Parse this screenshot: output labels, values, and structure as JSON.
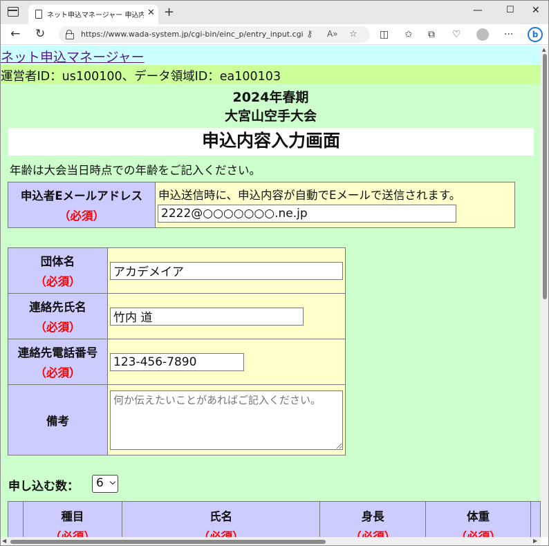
{
  "browser": {
    "tab_title": "ネット申込マネージャー 申込内容入力",
    "url": "https://www.wada-system.jp/cgi-bin/einc_p/entry_input.cgi",
    "icons": [
      "tab-actions-icon",
      "page-icon",
      "close-icon",
      "new-tab-icon",
      "minimize-icon",
      "maximize-icon",
      "window-close-icon",
      "back-icon",
      "refresh-icon",
      "lock-icon",
      "key-icon",
      "read-aloud-icon",
      "favorite-star-icon",
      "split-screen-icon",
      "favorites-icon",
      "collections-icon",
      "browser-essentials-icon",
      "profile-icon",
      "more-icon",
      "bing-icon"
    ]
  },
  "header": {
    "system_link": "ネット申込マネージャー",
    "operator_line": "運営者ID：us100100、データ領域ID：ea100103",
    "season": "2024年春期",
    "event_name": "大宮山空手大会",
    "page_heading": "申込内容入力画面",
    "age_note": "年齢は大会当日時点での年齢をご記入ください。"
  },
  "email_section": {
    "label": "申込者Eメールアドレス",
    "required": "（必須）",
    "hint": "申込送信時に、申込内容が自動でEメールで送信されます。",
    "value": "2222@○○○○○○○.ne.jp"
  },
  "group_form": {
    "org_label": "団体名",
    "org_required": "（必須）",
    "org_value": "アカデメイア",
    "contact_label": "連絡先氏名",
    "contact_required": "（必須）",
    "contact_value": "竹内 道",
    "phone_label": "連絡先電話番号",
    "phone_required": "（必須）",
    "phone_value": "123-456-7890",
    "remarks_label": "備考",
    "remarks_placeholder": "何か伝えたいことがあればご記入ください。"
  },
  "entries": {
    "count_label": "申し込む数：",
    "count_value": "6",
    "columns": [
      {
        "label": "種目",
        "required": "（必須）"
      },
      {
        "label": "氏名",
        "required": "（必須）"
      },
      {
        "label": "身長",
        "required": "（必須）"
      },
      {
        "label": "体重",
        "required": "（必須）"
      }
    ]
  },
  "colors": {
    "page_bg": "#ccffcc",
    "link_bar": "#ccffff",
    "id_bar": "#ccff99",
    "label_cell": "#ccccff",
    "value_cell": "#ffffcc",
    "required": "#ff0000"
  }
}
